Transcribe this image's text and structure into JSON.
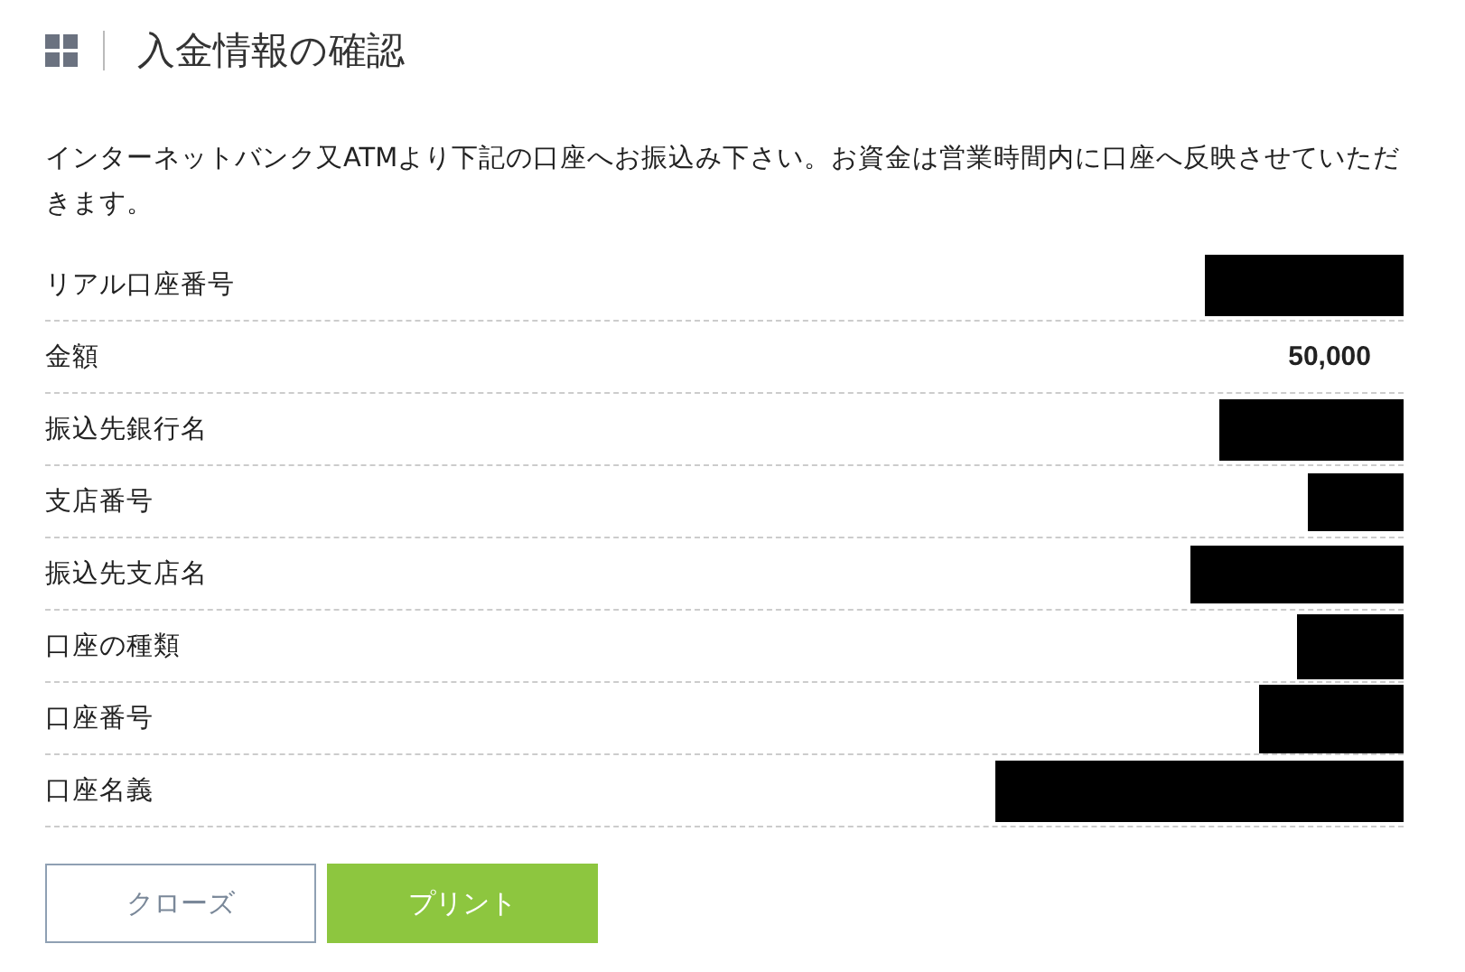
{
  "header": {
    "title": "入金情報の確認"
  },
  "message": "インターネットバンク又ATMより下記の口座へお振込み下さい。お資金は営業時間内に口座へ反映させていただきます。",
  "rows": [
    {
      "label": "リアル口座番号",
      "redacted": true
    },
    {
      "label": "金額",
      "value": "50,000",
      "redacted": false
    },
    {
      "label": "振込先銀行名",
      "redacted": true
    },
    {
      "label": "支店番号",
      "redacted": true
    },
    {
      "label": "振込先支店名",
      "redacted": true
    },
    {
      "label": "口座の種類",
      "redacted": true
    },
    {
      "label": "口座番号",
      "redacted": true
    },
    {
      "label": "口座名義",
      "redacted": true
    }
  ],
  "buttons": [
    {
      "label": "クローズ",
      "kind": "secondary"
    },
    {
      "label": "プリント",
      "kind": "primary"
    }
  ]
}
